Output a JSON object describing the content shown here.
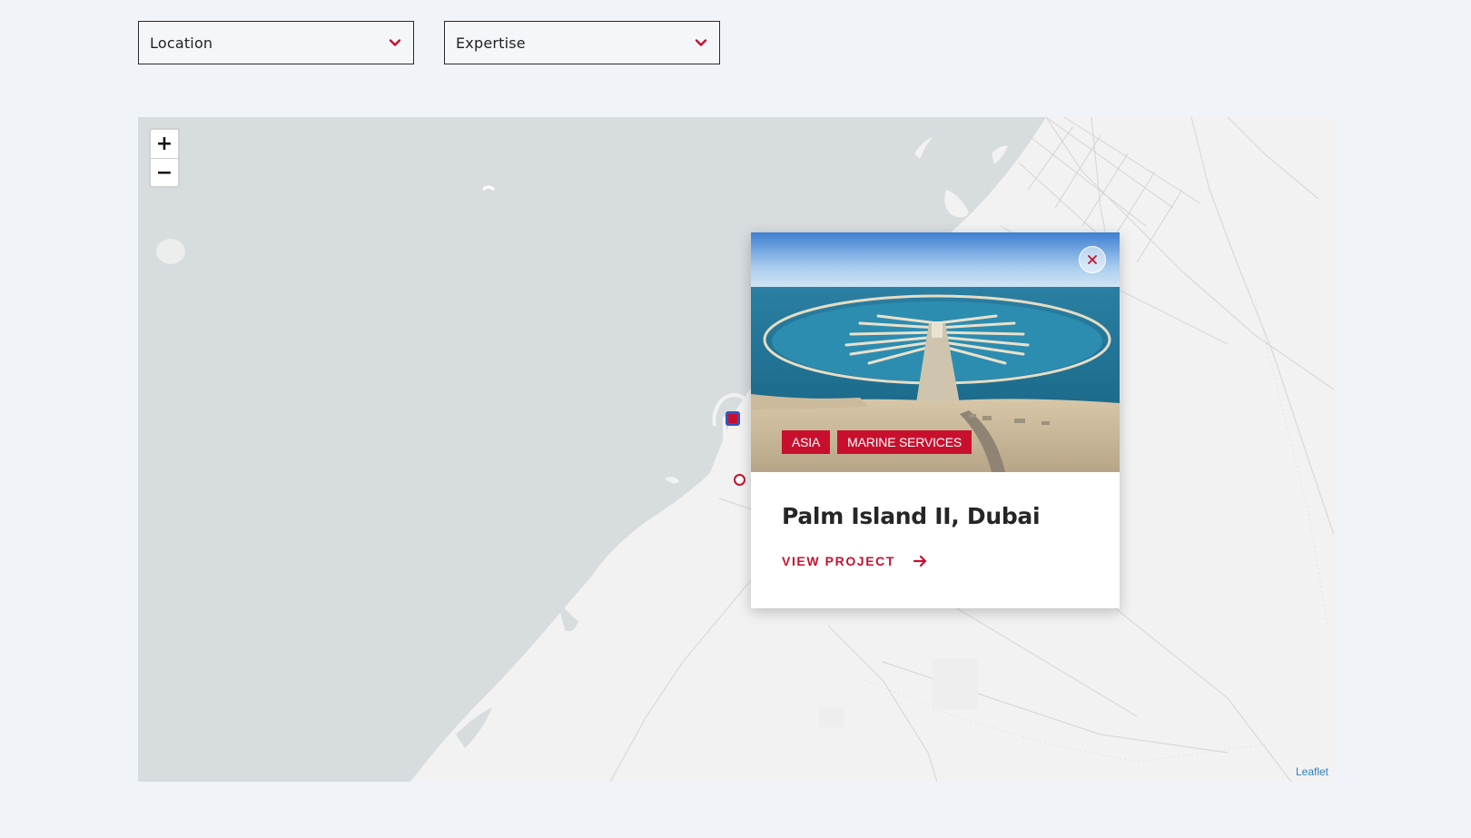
{
  "filters": {
    "location_label": "Location",
    "expertise_label": "Expertise"
  },
  "map": {
    "zoom_in": "+",
    "zoom_out": "−",
    "attribution": "Leaflet"
  },
  "popup": {
    "tags": [
      "ASIA",
      "MARINE SERVICES"
    ],
    "title": "Palm Island II, Dubai",
    "cta_label": "VIEW PROJECT"
  },
  "colors": {
    "accent": "#c8102e",
    "sea": "#d7dcdf",
    "land": "#f2f2f2",
    "page": "#f0f4f8"
  },
  "icons": {
    "dropdown": "chevron-down-icon",
    "close": "close-icon",
    "arrow": "arrow-right-icon"
  }
}
